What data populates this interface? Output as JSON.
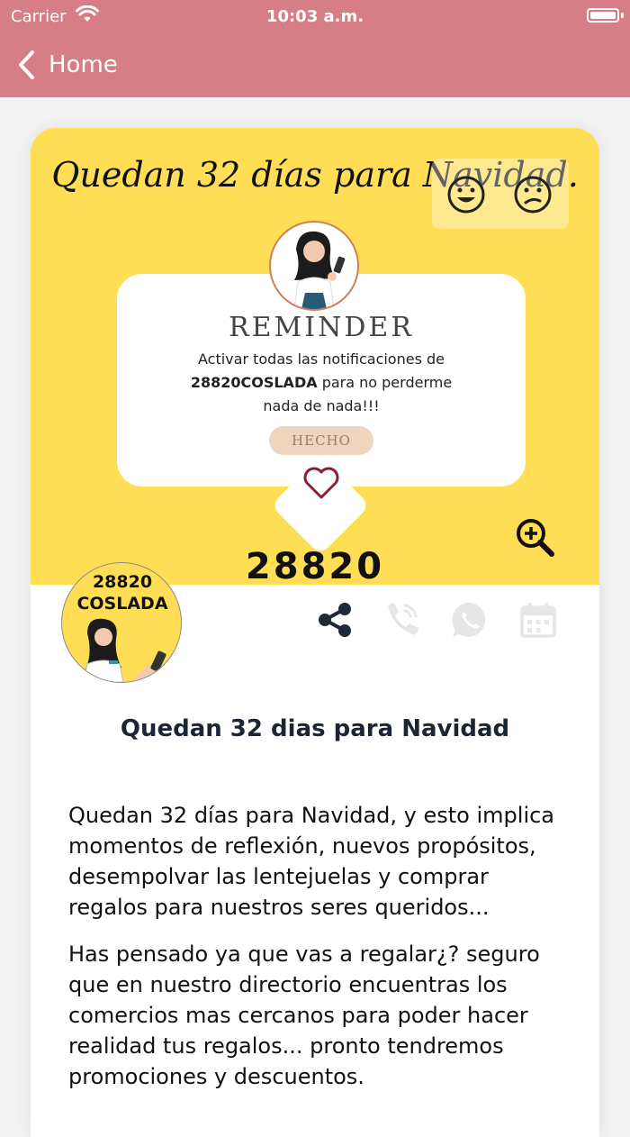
{
  "status": {
    "carrier": "Carrier",
    "time": "10:03 a.m."
  },
  "nav": {
    "back_label": "Home"
  },
  "hero": {
    "title": "Quedan 32 días para Navidad.",
    "reminder_title": "REMINDER",
    "reminder_line1": "Activar todas las notificaciones de",
    "reminder_brand": "28820COSLADA",
    "reminder_line2_rest": " para no perderme",
    "reminder_line3": "nada de nada!!!",
    "button_label": "HECHO",
    "big_number": "28820"
  },
  "logo": {
    "line1": "28820",
    "line2": "COSLADA"
  },
  "post": {
    "title": "Quedan 32 dias para Navidad",
    "paragraph1": "Quedan 32 días para Navidad, y esto implica momentos de reflexión, nuevos propósitos, desempolvar las lentejuelas y comprar regalos para nuestros seres queridos...",
    "paragraph2": "Has pensado ya que vas a regalar¿? seguro que en nuestro directorio encuentras los comercios mas cercanos para poder hacer realidad tus regalos... pronto tendremos promociones y descuentos."
  },
  "colors": {
    "topbar": "#d67d86",
    "hero_background": "#ffde55",
    "title_text": "#1c2536",
    "button_fill": "#f0d5be"
  },
  "icons": [
    "wifi-icon",
    "battery-icon",
    "chevron-left-icon",
    "happy-face-icon",
    "sad-face-icon",
    "heart-icon",
    "zoom-in-icon",
    "share-icon",
    "phone-icon",
    "whatsapp-icon",
    "calendar-icon"
  ]
}
